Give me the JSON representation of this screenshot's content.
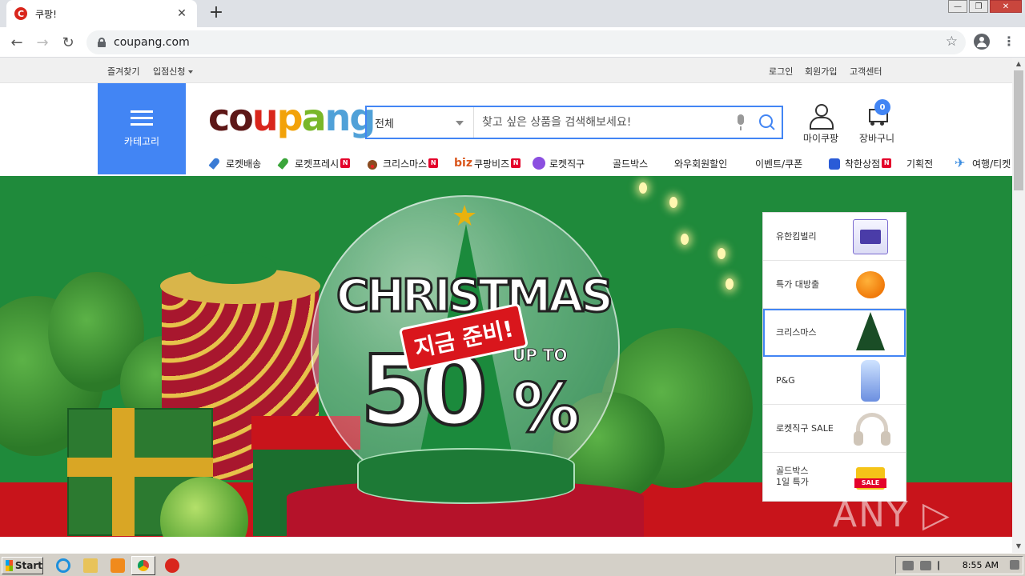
{
  "browser": {
    "tab_title": "쿠팡!",
    "tab_favicon": "C",
    "tab_close": "✕",
    "new_tab": "+",
    "url": "coupang.com",
    "window_buttons": [
      "—",
      "❐",
      "✕"
    ]
  },
  "topbar": {
    "left_links": [
      "즐겨찾기",
      "입점신청"
    ],
    "right_links": [
      "로그인",
      "회원가입",
      "고객센터"
    ]
  },
  "header": {
    "category_label": "카테고리",
    "logo_letters": [
      "c",
      "o",
      "u",
      "p",
      "a",
      "n",
      "g"
    ],
    "search": {
      "category": "전체",
      "placeholder": "찾고 싶은 상품을 검색해보세요!"
    },
    "my_coupang": "마이쿠팡",
    "cart_label": "장바구니",
    "cart_count": "0"
  },
  "catnav": [
    {
      "label": "로켓배송",
      "icon": "rocket-icon",
      "new": false
    },
    {
      "label": "로켓프레시",
      "icon": "rocket-fresh-icon",
      "new": true
    },
    {
      "label": "크리스마스",
      "icon": "reindeer-icon",
      "new": true
    },
    {
      "label": "쿠팡비즈",
      "prefix": "biz",
      "new": true
    },
    {
      "label": "로켓직구",
      "icon": "globe-icon",
      "new": false
    },
    {
      "label": "골드박스",
      "new": false
    },
    {
      "label": "와우회원할인",
      "new": false
    },
    {
      "label": "이벤트/쿠폰",
      "new": false
    },
    {
      "label": "착한상점",
      "icon": "gift-nav-icon",
      "new": true
    },
    {
      "label": "기획전",
      "new": false
    },
    {
      "label": "여행/티켓",
      "icon": "plane-icon",
      "new": false
    }
  ],
  "new_badge": "N",
  "banner": {
    "title": "CHRISTMAS",
    "badge": "지금 준비!",
    "upto": "UP TO",
    "number": "50",
    "percent": "%"
  },
  "promo_list": [
    {
      "label": "유한킴벌리",
      "thumb": "t-tissue",
      "active": false
    },
    {
      "label": "특가 대방출",
      "thumb": "t-tangerine",
      "active": false
    },
    {
      "label": "크리스마스",
      "thumb": "t-xtree",
      "active": true
    },
    {
      "label": "P&G",
      "thumb": "t-bottle",
      "active": false
    },
    {
      "label": "로켓직구 SALE",
      "thumb": "t-headphone",
      "active": false
    },
    {
      "label": "골드박스\n1일 특가",
      "thumb": "t-gift",
      "active": false
    }
  ],
  "promo_sale_tag": "SALE",
  "watermark": "ANY ▷ RUN",
  "taskbar": {
    "start": "Start",
    "clock": "8:55 AM"
  }
}
